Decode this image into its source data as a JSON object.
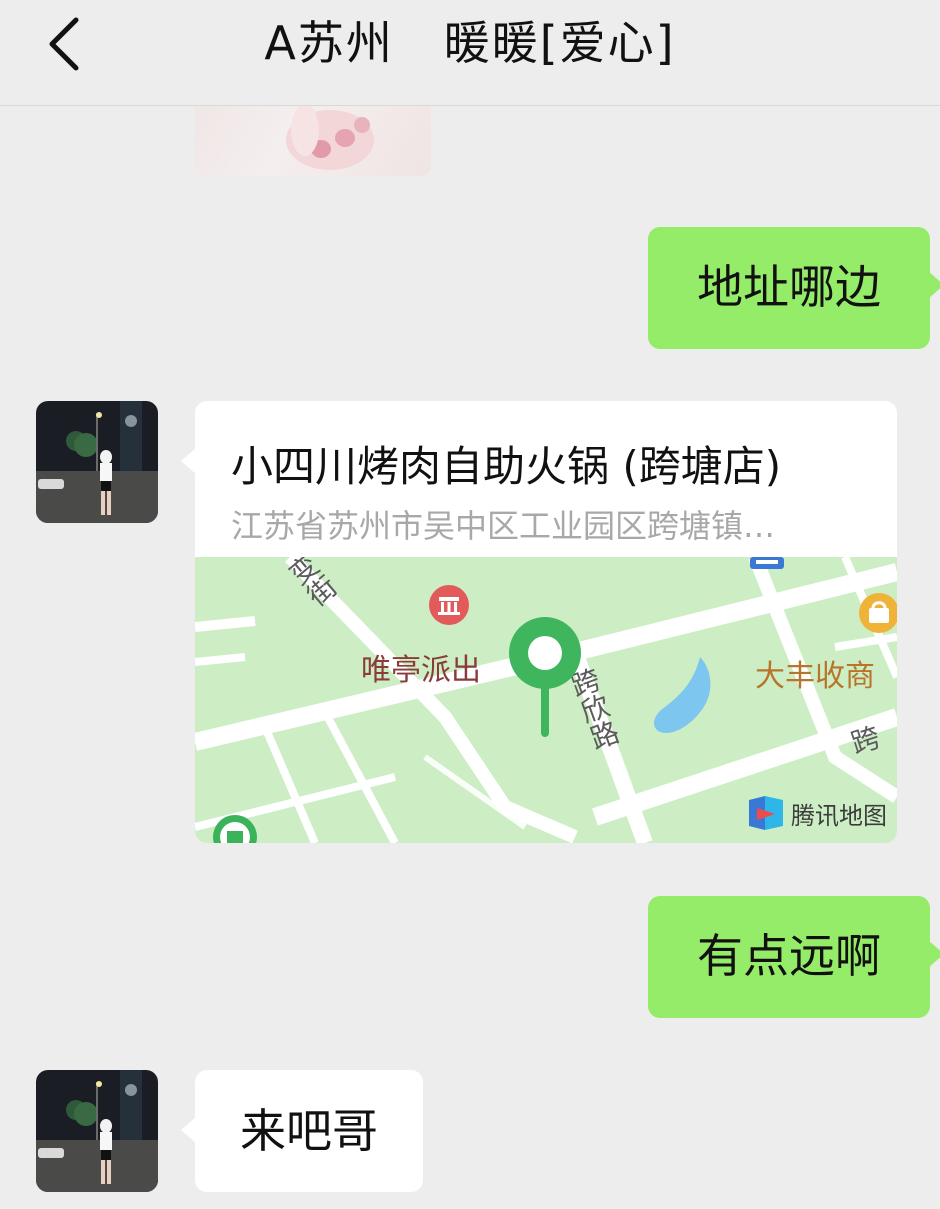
{
  "header": {
    "title": "A苏州   暖暖[爱心]"
  },
  "messages": {
    "out1": "地址哪边",
    "out2": "有点远啊",
    "in_last": "来吧哥"
  },
  "location": {
    "name": "小四川烤肉自助火锅 (跨塘店)",
    "address": "江苏省苏州市吴中区工业园区跨塘镇…",
    "map_labels": {
      "police": "唯亭派出",
      "road": "跨欣路",
      "shop": "大丰收商",
      "road_partial": "跨",
      "street_partial": "变街",
      "brand": "腾讯地图"
    }
  },
  "colors": {
    "background": "#ededed",
    "out_bubble": "#95ec69",
    "in_bubble": "#ffffff",
    "map_green": "#cdeec4",
    "pin": "#3fb55e"
  }
}
